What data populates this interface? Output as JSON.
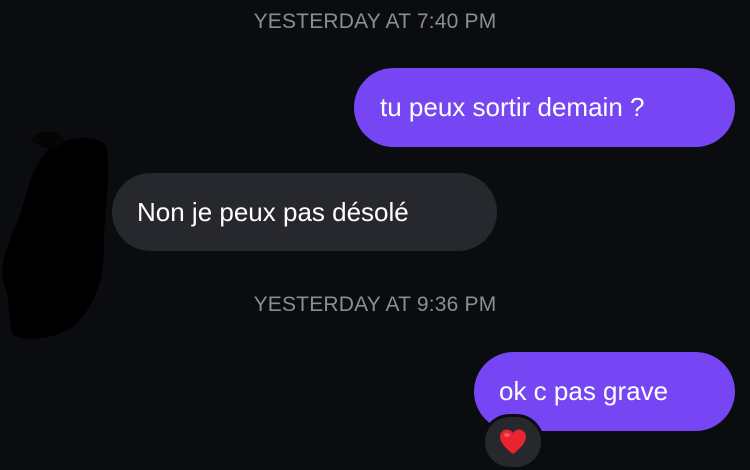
{
  "conversation": {
    "timestamps": [
      "YESTERDAY AT 7:40 PM",
      "YESTERDAY AT 9:36 PM"
    ],
    "messages": [
      {
        "direction": "outgoing",
        "text": "tu peux sortir demain ?"
      },
      {
        "direction": "incoming",
        "text": "Non je peux pas désolé"
      },
      {
        "direction": "outgoing",
        "text": "ok c pas grave"
      }
    ],
    "reaction": {
      "icon": "heart-icon",
      "color": "#e8252f"
    }
  },
  "colors": {
    "background": "#0b0c10",
    "outgoing_bubble": "#7646f4",
    "incoming_bubble": "#26282d",
    "timestamp_text": "#8b8d93"
  }
}
